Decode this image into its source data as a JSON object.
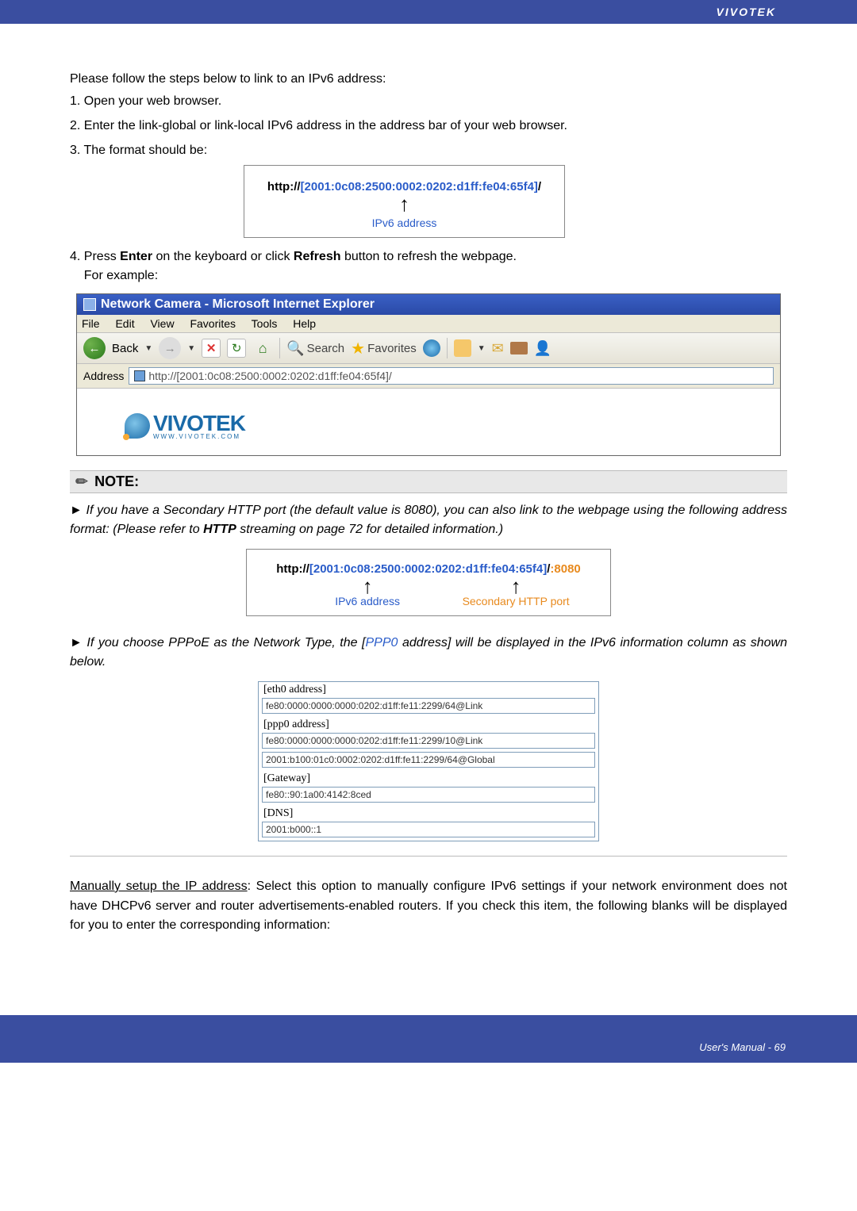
{
  "brand": "VIVOTEK",
  "intro": "Please follow the steps below to link to an IPv6 address:",
  "step1": "1. Open your web browser.",
  "step2": "2. Enter the link-global or link-local IPv6 address in the address bar of your web browser.",
  "step3": "3. The format should be:",
  "url_box1": {
    "prefix": "http://",
    "ipv6": "[2001:0c08:2500:0002:0202:d1ff:fe04:65f4]",
    "suffix": "/",
    "caption": "IPv6 address"
  },
  "step4a": "4. Press ",
  "step4_enter": "Enter",
  "step4b": " on the keyboard or click ",
  "step4_refresh": "Refresh",
  "step4c": " button to refresh the webpage.",
  "step4d": "For example:",
  "ie": {
    "title": "Network Camera - Microsoft Internet Explorer",
    "menu": {
      "file": "File",
      "edit": "Edit",
      "view": "View",
      "fav": "Favorites",
      "tools": "Tools",
      "help": "Help"
    },
    "toolbar": {
      "back": "Back",
      "search": "Search",
      "favorites": "Favorites"
    },
    "address_label": "Address",
    "address_value": "http://[2001:0c08:2500:0002:0202:d1ff:fe04:65f4]/",
    "logo_text": "VIVOTEK",
    "logo_sub": "WWW.VIVOTEK.COM"
  },
  "note_label": "NOTE:",
  "note1a": "► If you have a Secondary HTTP port (the default value is 8080), you can also link to the webpage using the following address format: (Please refer to ",
  "note1_http": "HTTP",
  "note1b": " streaming on page 72 for detailed information.)",
  "url_box2": {
    "prefix": "http://",
    "ipv6": "[2001:0c08:2500:0002:0202:d1ff:fe04:65f4]",
    "suffix": "/",
    "port": ":8080",
    "caption_ipv6": "IPv6 address",
    "caption_port": "Secondary HTTP port"
  },
  "note2a": "► If you choose PPPoE as the Network Type, the [",
  "note2_ppp0": "PPP0",
  "note2b": " address] will be displayed in the IPv6 information column as shown below.",
  "ipv6info": {
    "eth0_label": "[eth0 address]",
    "eth0_val": "fe80:0000:0000:0000:0202:d1ff:fe11:2299/64@Link",
    "ppp0_label": "[ppp0 address]",
    "ppp0_val1": "fe80:0000:0000:0000:0202:d1ff:fe11:2299/10@Link",
    "ppp0_val2": "2001:b100:01c0:0002:0202:d1ff:fe11:2299/64@Global",
    "gw_label": "[Gateway]",
    "gw_val": "fe80::90:1a00:4142:8ced",
    "dns_label": "[DNS]",
    "dns_val": "2001:b000::1"
  },
  "manual_u": "Manually setup the IP address",
  "manual_rest": ": Select this option to manually configure IPv6 settings if your network environment does not have DHCPv6 server and router advertisements-enabled routers. If you check this item, the following blanks will be displayed for you to enter the corresponding information:",
  "footer": "User's Manual - 69"
}
